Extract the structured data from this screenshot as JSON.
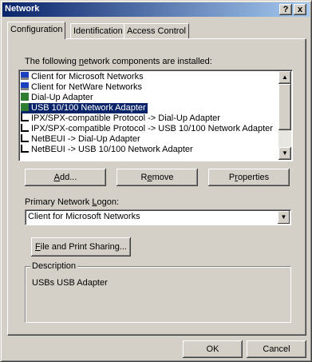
{
  "window": {
    "title": "Network",
    "help_button": "?",
    "close_button": "x"
  },
  "tabs": [
    {
      "label": "Configuration",
      "active": true
    },
    {
      "label": "Identification",
      "active": false
    },
    {
      "label": "Access Control",
      "active": false
    }
  ],
  "components": {
    "label_prefix": "The following ",
    "label_underlined": "n",
    "label_suffix": "etwork components are installed:",
    "items": [
      {
        "label": "Client for Microsoft Networks",
        "icon": "client-icon",
        "selected": false
      },
      {
        "label": "Client for NetWare Networks",
        "icon": "client-icon",
        "selected": false
      },
      {
        "label": "Dial-Up Adapter",
        "icon": "adapter-icon",
        "selected": false
      },
      {
        "label": "USB 10/100 Network Adapter",
        "icon": "adapter-icon",
        "selected": true
      },
      {
        "label": "IPX/SPX-compatible Protocol -> Dial-Up Adapter",
        "icon": "protocol-icon",
        "selected": false
      },
      {
        "label": "IPX/SPX-compatible Protocol -> USB 10/100 Network Adapter",
        "icon": "protocol-icon",
        "selected": false
      },
      {
        "label": "NetBEUI -> Dial-Up Adapter",
        "icon": "protocol-icon",
        "selected": false
      },
      {
        "label": "NetBEUI -> USB 10/100 Network Adapter",
        "icon": "protocol-icon",
        "selected": false
      }
    ]
  },
  "buttons": {
    "add_u": "A",
    "add_rest": "dd...",
    "remove_pre": "R",
    "remove_u": "e",
    "remove_rest": "move",
    "properties_pre": "P",
    "properties_u": "r",
    "properties_rest": "operties"
  },
  "logon": {
    "label_prefix": "Primary Network ",
    "label_underlined": "L",
    "label_suffix": "ogon:",
    "value": "Client for Microsoft Networks"
  },
  "sharing": {
    "u": "F",
    "rest": "ile and Print Sharing..."
  },
  "description": {
    "legend": "Description",
    "text": "USBs USB Adapter"
  },
  "dialog": {
    "ok_label": "OK",
    "cancel_label": "Cancel"
  },
  "colors": {
    "title_start": "#0a246a",
    "title_end": "#a6caf0",
    "selection": "#0a246a",
    "face": "#d4d0c8"
  }
}
